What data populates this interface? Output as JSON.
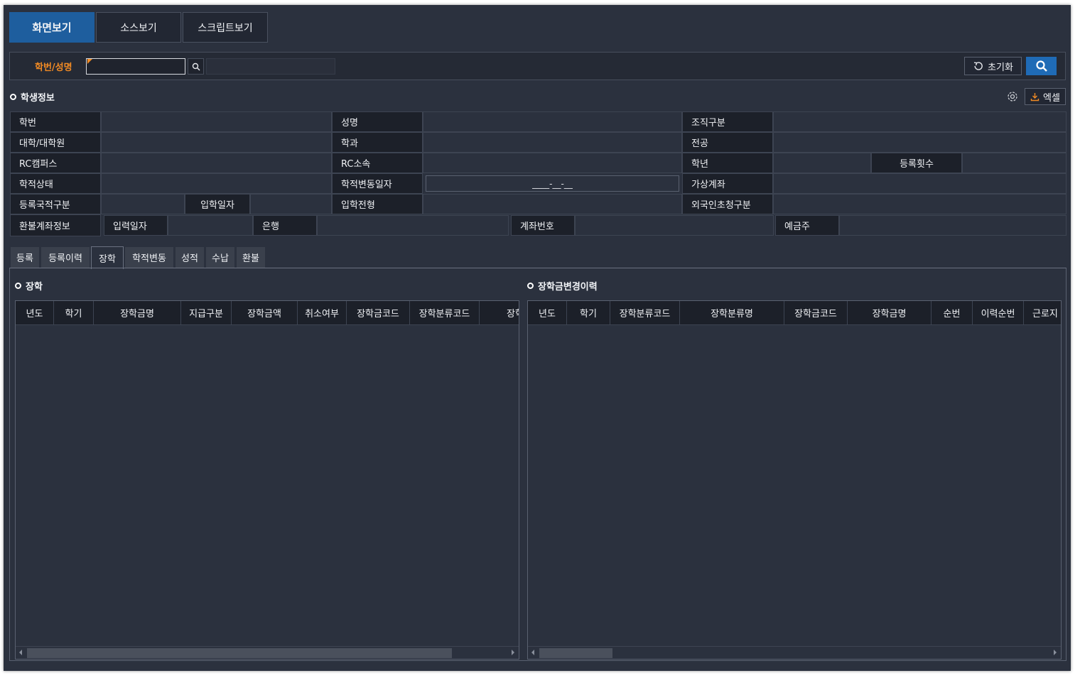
{
  "top_tabs": [
    {
      "label": "화면보기",
      "active": true
    },
    {
      "label": "소스보기",
      "active": false
    },
    {
      "label": "스크립트보기",
      "active": false
    }
  ],
  "search": {
    "label": "학번/성명",
    "value": "",
    "reset_label": "초기화"
  },
  "student_info": {
    "title": "학생정보",
    "excel_label": "엑셀",
    "fields": {
      "student_id": "학번",
      "name": "성명",
      "org_type": "조직구분",
      "college": "대학/대학원",
      "department": "학과",
      "major": "전공",
      "rc_campus": "RC캠퍼스",
      "rc_affiliation": "RC소속",
      "grade": "학년",
      "reg_count": "등록횟수",
      "status": "학적상태",
      "status_change_date": "학적변동일자",
      "status_change_date_value": "____-__-__",
      "virtual_account": "가상계좌",
      "reg_nationality": "등록국적구분",
      "admission_date": "입학일자",
      "admission_type": "입학전형",
      "foreign_invite": "외국인초청구분",
      "refund_account": "환불계좌정보",
      "input_date": "입력일자",
      "bank": "은행",
      "account_no": "계좌번호",
      "depositor": "예금주"
    }
  },
  "bottom_tabs": [
    {
      "label": "등록",
      "active": false
    },
    {
      "label": "등록이력",
      "active": false
    },
    {
      "label": "장학",
      "active": true
    },
    {
      "label": "학적변동",
      "active": false
    },
    {
      "label": "성적",
      "active": false
    },
    {
      "label": "수납",
      "active": false
    },
    {
      "label": "환불",
      "active": false
    }
  ],
  "scholarship": {
    "title": "장학",
    "columns": [
      "년도",
      "학기",
      "장학금명",
      "지급구분",
      "장학금액",
      "취소여부",
      "장학금코드",
      "장학분류코드",
      "장학"
    ]
  },
  "scholarship_history": {
    "title": "장학금변경이력",
    "columns": [
      "년도",
      "학기",
      "장학분류코드",
      "장학분류명",
      "장학금코드",
      "장학금명",
      "순번",
      "이력순번",
      "근로지"
    ]
  },
  "colors": {
    "background": "#2b313e",
    "label_bg": "#1c2029",
    "accent_blue": "#1f6bb6",
    "accent_orange": "#f08a24"
  }
}
